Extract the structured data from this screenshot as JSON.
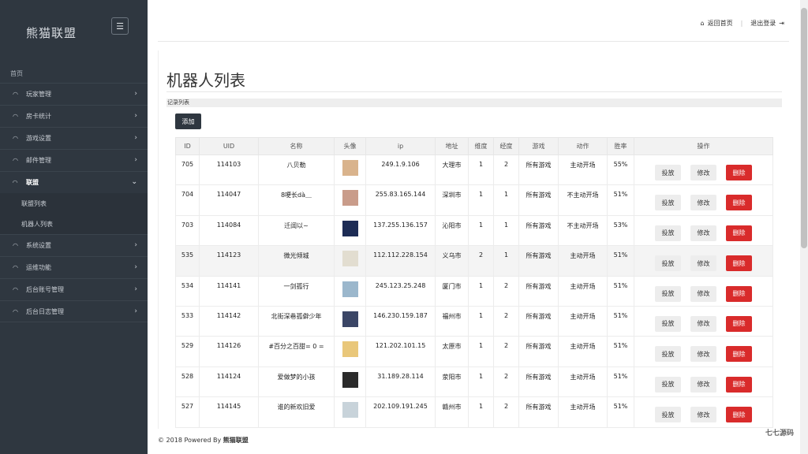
{
  "app": {
    "brand": "熊猫联盟"
  },
  "sidebar": {
    "home": "首页",
    "items": [
      {
        "label": "玩家管理",
        "icon": "gauge-icon"
      },
      {
        "label": "房卡统计",
        "icon": "gauge-icon"
      },
      {
        "label": "游戏设置",
        "icon": "gauge-icon"
      },
      {
        "label": "邮件管理",
        "icon": "gauge-icon"
      },
      {
        "label": "联盟",
        "icon": "gauge-icon",
        "expanded": true,
        "subitems": [
          "联盟列表",
          "机器人列表"
        ]
      },
      {
        "label": "系统设置",
        "icon": "gauge-icon"
      },
      {
        "label": "运维功能",
        "icon": "gauge-icon"
      },
      {
        "label": "后台账号管理",
        "icon": "gauge-icon"
      },
      {
        "label": "后台日志管理",
        "icon": "gauge-icon"
      }
    ]
  },
  "topbar": {
    "home_link": "返回首页",
    "logout": "退出登录"
  },
  "page": {
    "title": "机器人列表",
    "caption": "记录列表",
    "add_label": "添加"
  },
  "table": {
    "headers": [
      "ID",
      "UID",
      "名称",
      "头像",
      "ip",
      "地址",
      "维度",
      "经度",
      "游戏",
      "动作",
      "胜率",
      "操作"
    ],
    "rows": [
      {
        "id": "705",
        "uid": "114103",
        "name": "八贝勒",
        "avatar_color": "#d9b38c",
        "ip": "249.1.9.106",
        "addr": "大理市",
        "lat": "1",
        "lng": "2",
        "game": "所有游戏",
        "action": "主动开场",
        "rate": "55%"
      },
      {
        "id": "704",
        "uid": "114047",
        "name": "8哽长dà＿",
        "avatar_color": "#c99c8a",
        "ip": "255.83.165.144",
        "addr": "深圳市",
        "lat": "1",
        "lng": "1",
        "game": "所有游戏",
        "action": "不主动开场",
        "rate": "51%"
      },
      {
        "id": "703",
        "uid": "114084",
        "name": "迁阔以~",
        "avatar_color": "#1d2c55",
        "ip": "137.255.136.157",
        "addr": "沁阳市",
        "lat": "1",
        "lng": "1",
        "game": "所有游戏",
        "action": "不主动开场",
        "rate": "53%"
      },
      {
        "id": "535",
        "uid": "114123",
        "name": "微光倾城",
        "avatar_color": "#e2ddd0",
        "ip": "112.112.228.154",
        "addr": "义乌市",
        "lat": "2",
        "lng": "1",
        "game": "所有游戏",
        "action": "主动开场",
        "rate": "51%"
      },
      {
        "id": "534",
        "uid": "114141",
        "name": "一剑孤行",
        "avatar_color": "#9bb7cc",
        "ip": "245.123.25.248",
        "addr": "厦门市",
        "lat": "1",
        "lng": "2",
        "game": "所有游戏",
        "action": "主动开场",
        "rate": "51%"
      },
      {
        "id": "533",
        "uid": "114142",
        "name": "北街深巷孤僻少年",
        "avatar_color": "#3b4666",
        "ip": "146.230.159.187",
        "addr": "福州市",
        "lat": "1",
        "lng": "2",
        "game": "所有游戏",
        "action": "主动开场",
        "rate": "51%"
      },
      {
        "id": "529",
        "uid": "114126",
        "name": "#百分之百甜= 0 =",
        "avatar_color": "#e9c77a",
        "ip": "121.202.101.15",
        "addr": "太原市",
        "lat": "1",
        "lng": "2",
        "game": "所有游戏",
        "action": "主动开场",
        "rate": "51%"
      },
      {
        "id": "528",
        "uid": "114124",
        "name": "爱做梦的小孩",
        "avatar_color": "#2b2b2b",
        "ip": "31.189.28.114",
        "addr": "荥阳市",
        "lat": "1",
        "lng": "2",
        "game": "所有游戏",
        "action": "主动开场",
        "rate": "51%"
      },
      {
        "id": "527",
        "uid": "114145",
        "name": "谁的新欢旧爱",
        "avatar_color": "#c8d3da",
        "ip": "202.109.191.245",
        "addr": "赣州市",
        "lat": "1",
        "lng": "2",
        "game": "所有游戏",
        "action": "主动开场",
        "rate": "51%"
      }
    ],
    "ops": {
      "deliver": "投放",
      "edit": "修改",
      "delete": "删除"
    }
  },
  "footer": {
    "prefix": "© 2018 Powered By ",
    "brand": "熊猫联盟"
  },
  "watermark": "七七源码"
}
